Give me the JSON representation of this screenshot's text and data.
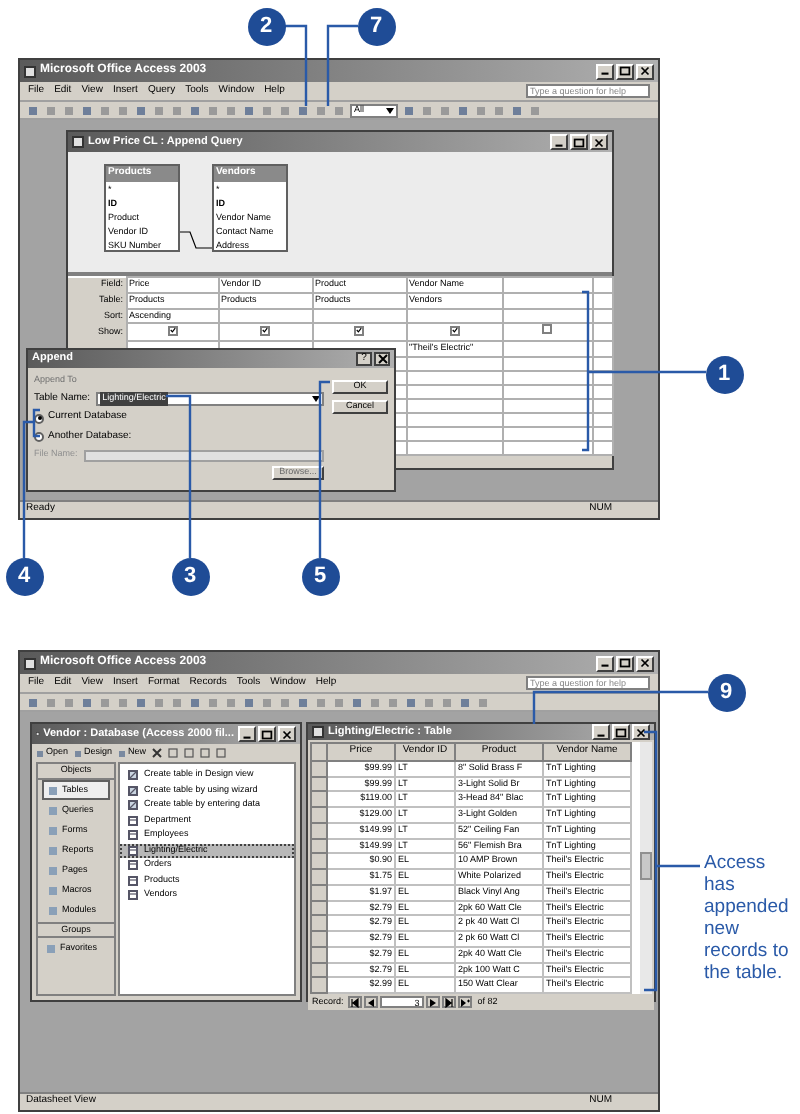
{
  "top": {
    "callouts": [
      "2",
      "7",
      "1",
      "4",
      "3",
      "5"
    ],
    "app_title": "Microsoft Office Access 2003",
    "menu": [
      "File",
      "Edit",
      "View",
      "Insert",
      "Query",
      "Tools",
      "Window",
      "Help"
    ],
    "help_placeholder": "Type a question for help",
    "toolbar_combo": "All",
    "query_window": {
      "title": "Low Price CL : Append Query",
      "tables": [
        {
          "title": "Products",
          "fields": [
            {
              "name": "*",
              "key": false
            },
            {
              "name": "ID",
              "key": true
            },
            {
              "name": "Product",
              "key": false
            },
            {
              "name": "Vendor ID",
              "key": false
            },
            {
              "name": "SKU Number",
              "key": false
            }
          ]
        },
        {
          "title": "Vendors",
          "fields": [
            {
              "name": "*",
              "key": false
            },
            {
              "name": "ID",
              "key": true
            },
            {
              "name": "Vendor Name",
              "key": false
            },
            {
              "name": "Contact Name",
              "key": false
            },
            {
              "name": "Address",
              "key": false
            }
          ]
        }
      ],
      "row_labels": [
        "Field:",
        "Table:",
        "Sort:",
        "Show:"
      ],
      "columns": [
        {
          "field": "Price",
          "table": "Products",
          "sort": "Ascending",
          "show": true
        },
        {
          "field": "Vendor ID",
          "table": "Products",
          "show": true
        },
        {
          "field": "Product",
          "table": "Products",
          "show": true
        },
        {
          "field": "Vendor Name",
          "table": "Vendors",
          "show": true,
          "criteria": "\"Theil's Electric\""
        },
        {
          "show": false
        }
      ]
    },
    "dialog": {
      "title": "Append",
      "help_button": "?",
      "group_label": "Append To",
      "table_name_label": "Table Name:",
      "table_name": "Lighting/Electric",
      "radios": [
        {
          "label": "Current Database",
          "selected": true
        },
        {
          "label": "Another Database:",
          "selected": false
        }
      ],
      "file_name_label": "File Name:",
      "buttons": [
        {
          "label": "OK",
          "disabled": false
        },
        {
          "label": "Cancel",
          "disabled": false
        },
        {
          "label": "Browse...",
          "disabled": true
        }
      ]
    },
    "status": {
      "left": "Ready",
      "right": "NUM"
    }
  },
  "bottom": {
    "callouts": [
      "9"
    ],
    "app_title": "Microsoft Office Access 2003",
    "menu": [
      "File",
      "Edit",
      "View",
      "Insert",
      "Format",
      "Records",
      "Tools",
      "Window",
      "Help"
    ],
    "help_placeholder": "Type a question for help",
    "db_window": {
      "title": "Vendor : Database (Access 2000 fil...",
      "toolbar": [
        "Open",
        "Design",
        "New"
      ],
      "objects_header": "Objects",
      "objects": [
        {
          "label": "Tables",
          "selected": true
        },
        {
          "label": "Queries",
          "selected": false
        },
        {
          "label": "Forms",
          "selected": false
        },
        {
          "label": "Reports",
          "selected": false
        },
        {
          "label": "Pages",
          "selected": false
        },
        {
          "label": "Macros",
          "selected": false
        },
        {
          "label": "Modules",
          "selected": false
        }
      ],
      "groups_header": "Groups",
      "groups": [
        "Favorites"
      ],
      "items": [
        {
          "label": "Create table in Design view",
          "kind": "shortcut",
          "selected": false
        },
        {
          "label": "Create table by using wizard",
          "kind": "shortcut",
          "selected": false
        },
        {
          "label": "Create table by entering data",
          "kind": "shortcut",
          "selected": false
        },
        {
          "label": "Department",
          "kind": "table",
          "selected": false
        },
        {
          "label": "Employees",
          "kind": "table",
          "selected": false
        },
        {
          "label": "Lighting/Electric",
          "kind": "table",
          "selected": true
        },
        {
          "label": "Orders",
          "kind": "table",
          "selected": false
        },
        {
          "label": "Products",
          "kind": "table",
          "selected": false
        },
        {
          "label": "Vendors",
          "kind": "table",
          "selected": false
        }
      ]
    },
    "table_window": {
      "title": "Lighting/Electric : Table",
      "columns": [
        "Price",
        "Vendor ID",
        "Product",
        "Vendor Name"
      ],
      "rows": [
        [
          "$99.99",
          "LT",
          "8\" Solid Brass F",
          "TnT Lighting"
        ],
        [
          "$99.99",
          "LT",
          "3-Light Solid Br",
          "TnT Lighting"
        ],
        [
          "$119.00",
          "LT",
          "3-Head 84\" Blac",
          "TnT Lighting"
        ],
        [
          "$129.00",
          "LT",
          "3-Light Golden",
          "TnT Lighting"
        ],
        [
          "$149.99",
          "LT",
          "52\" Ceiling Fan",
          "TnT Lighting"
        ],
        [
          "$149.99",
          "LT",
          "56\" Flemish Bra",
          "TnT Lighting"
        ],
        [
          "$0.90",
          "EL",
          "10 AMP Brown",
          "Theil's Electric"
        ],
        [
          "$1.75",
          "EL",
          "White Polarized",
          "Theil's Electric"
        ],
        [
          "$1.97",
          "EL",
          "Black Vinyl Ang",
          "Theil's Electric"
        ],
        [
          "$2.79",
          "EL",
          "2pk 60 Watt Cle",
          "Theil's Electric"
        ],
        [
          "$2.79",
          "EL",
          "2 pk 40 Watt Cl",
          "Theil's Electric"
        ],
        [
          "$2.79",
          "EL",
          "2 pk 60 Watt Cl",
          "Theil's Electric"
        ],
        [
          "$2.79",
          "EL",
          "2pk 40 Watt Cle",
          "Theil's Electric"
        ],
        [
          "$2.79",
          "EL",
          "2pk 100 Watt C",
          "Theil's Electric"
        ],
        [
          "$2.99",
          "EL",
          "150 Watt Clear",
          "Theil's Electric"
        ]
      ],
      "nav_label": "Record:",
      "record": "3",
      "of": "of 82"
    },
    "status": {
      "left": "Datasheet View",
      "right": "NUM"
    }
  },
  "caption": "Access has appended new records to the table."
}
